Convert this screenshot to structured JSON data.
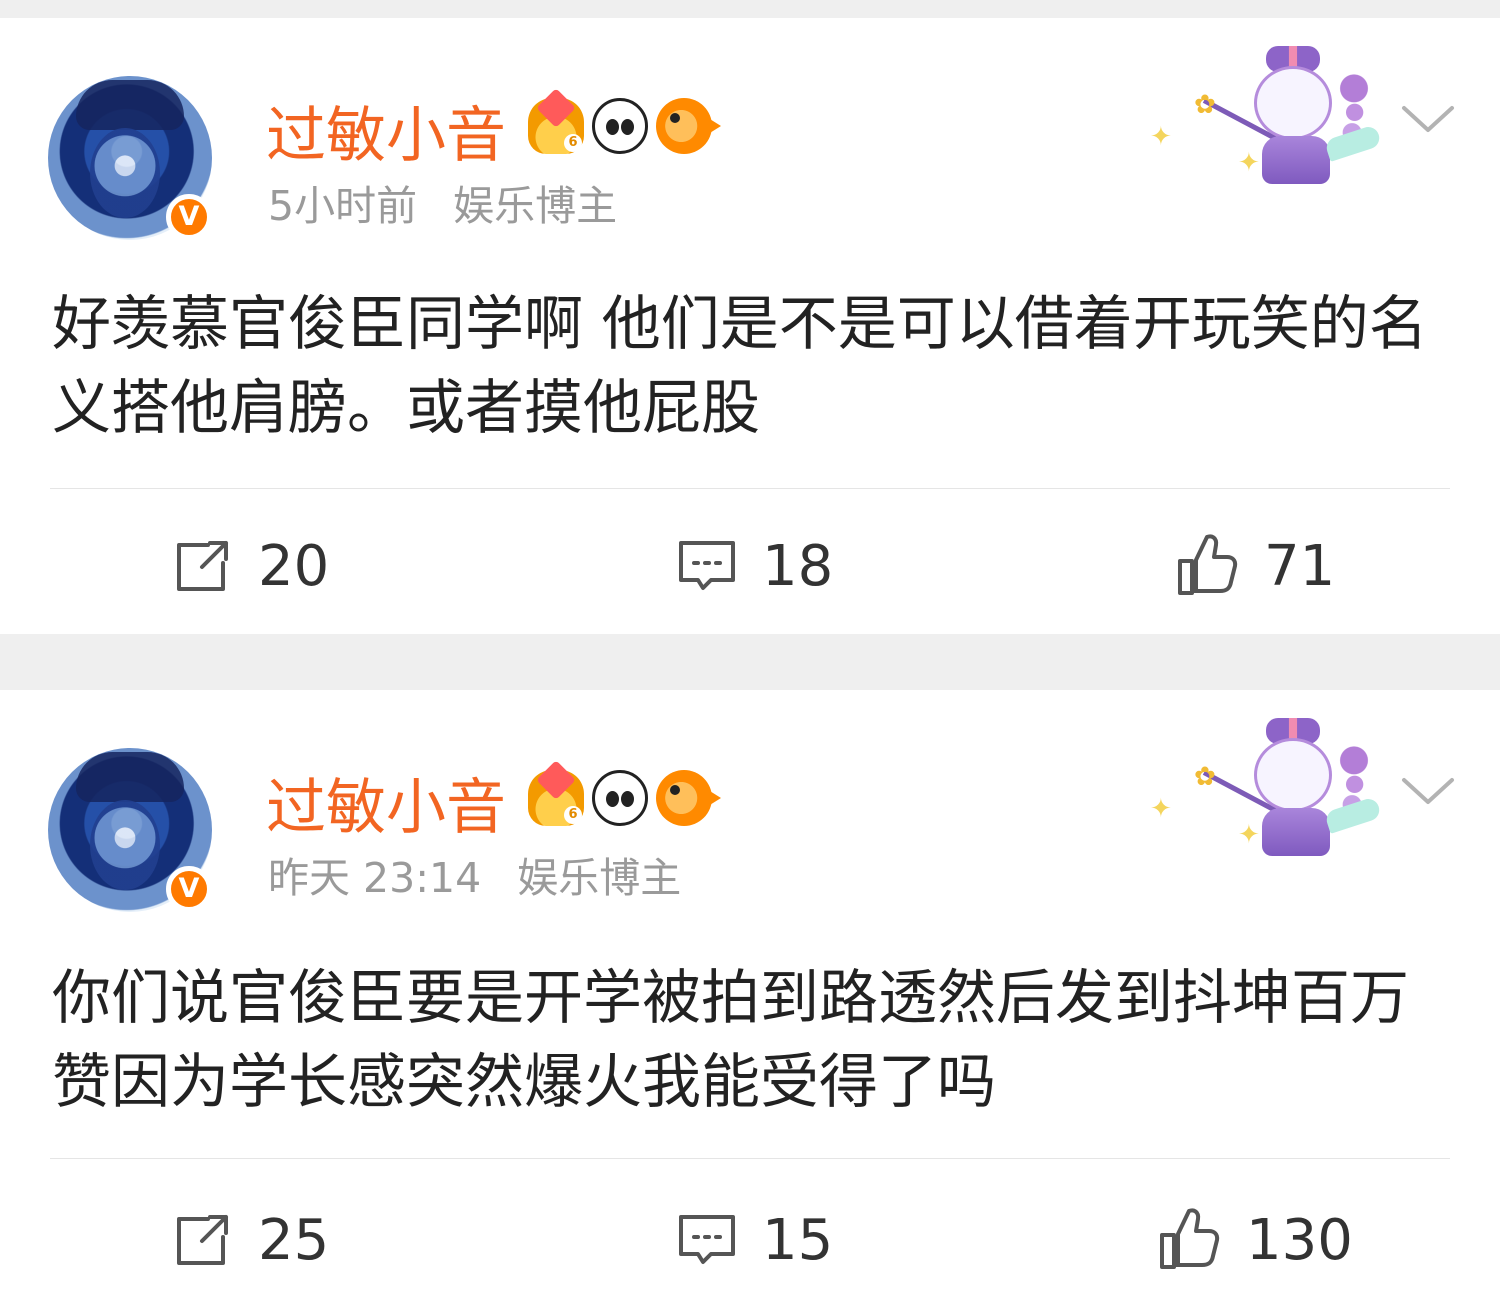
{
  "posts": [
    {
      "author": {
        "name": "过敏小音",
        "verified_badge": "V",
        "badges": [
          "crown-level-6-icon",
          "panda-icon",
          "fish-icon"
        ]
      },
      "meta": {
        "time": "5小时前",
        "role": "娱乐博主"
      },
      "content": "好羡慕官俊臣同学啊 他们是不是可以借着开玩笑的名义搭他肩膀。或者摸他屁股",
      "actions": {
        "repost_count": "20",
        "comment_count": "18",
        "like_count": "71"
      }
    },
    {
      "author": {
        "name": "过敏小音",
        "verified_badge": "V",
        "badges": [
          "crown-level-6-icon",
          "panda-icon",
          "fish-icon"
        ]
      },
      "meta": {
        "time": "昨天 23:14",
        "role": "娱乐博主"
      },
      "content": "你们说官俊臣要是开学被拍到路透然后发到抖坤百万赞因为学长感突然爆火我能受得了吗",
      "actions": {
        "repost_count": "25",
        "comment_count": "15",
        "like_count": "130"
      }
    }
  ],
  "colors": {
    "username": "#f26522",
    "meta": "#9a9a9a",
    "text": "#222222",
    "icon": "#555555",
    "background": "#efefef",
    "card": "#ffffff",
    "verified_badge": "#ff7a00"
  }
}
